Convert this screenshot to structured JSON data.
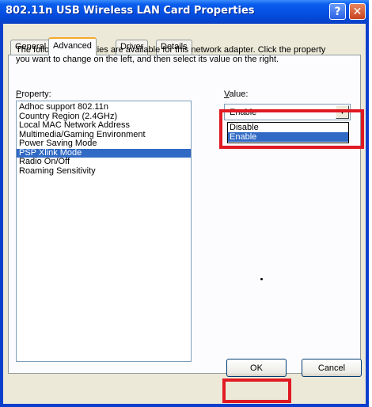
{
  "window": {
    "title": "802.11n USB Wireless LAN Card Properties",
    "help_button": "?",
    "close_button": "✕"
  },
  "tabs": [
    {
      "label": "General"
    },
    {
      "label": "Advanced"
    },
    {
      "label": "Driver"
    },
    {
      "label": "Details"
    }
  ],
  "advanced": {
    "description": "The following properties are available for this network adapter. Click the property you want to change on the left, and then select its value on the right.",
    "property_label": "Property:",
    "properties": [
      "Adhoc support 802.11n",
      "Country Region (2.4GHz)",
      "Local MAC Network Address",
      "Multimedia/Gaming Environment",
      "Power Saving Mode",
      "PSP Xlink Mode",
      "Radio On/Off",
      "Roaming Sensitivity"
    ],
    "selected_property": "PSP Xlink Mode",
    "value_label": "Value:",
    "value_selected": "Enable",
    "value_options": [
      "Disable",
      "Enable"
    ]
  },
  "buttons": {
    "ok": "OK",
    "cancel": "Cancel"
  },
  "colors": {
    "highlight_box": "#e01a23",
    "selection": "#316ac5",
    "title_bar": "#0550e3"
  }
}
